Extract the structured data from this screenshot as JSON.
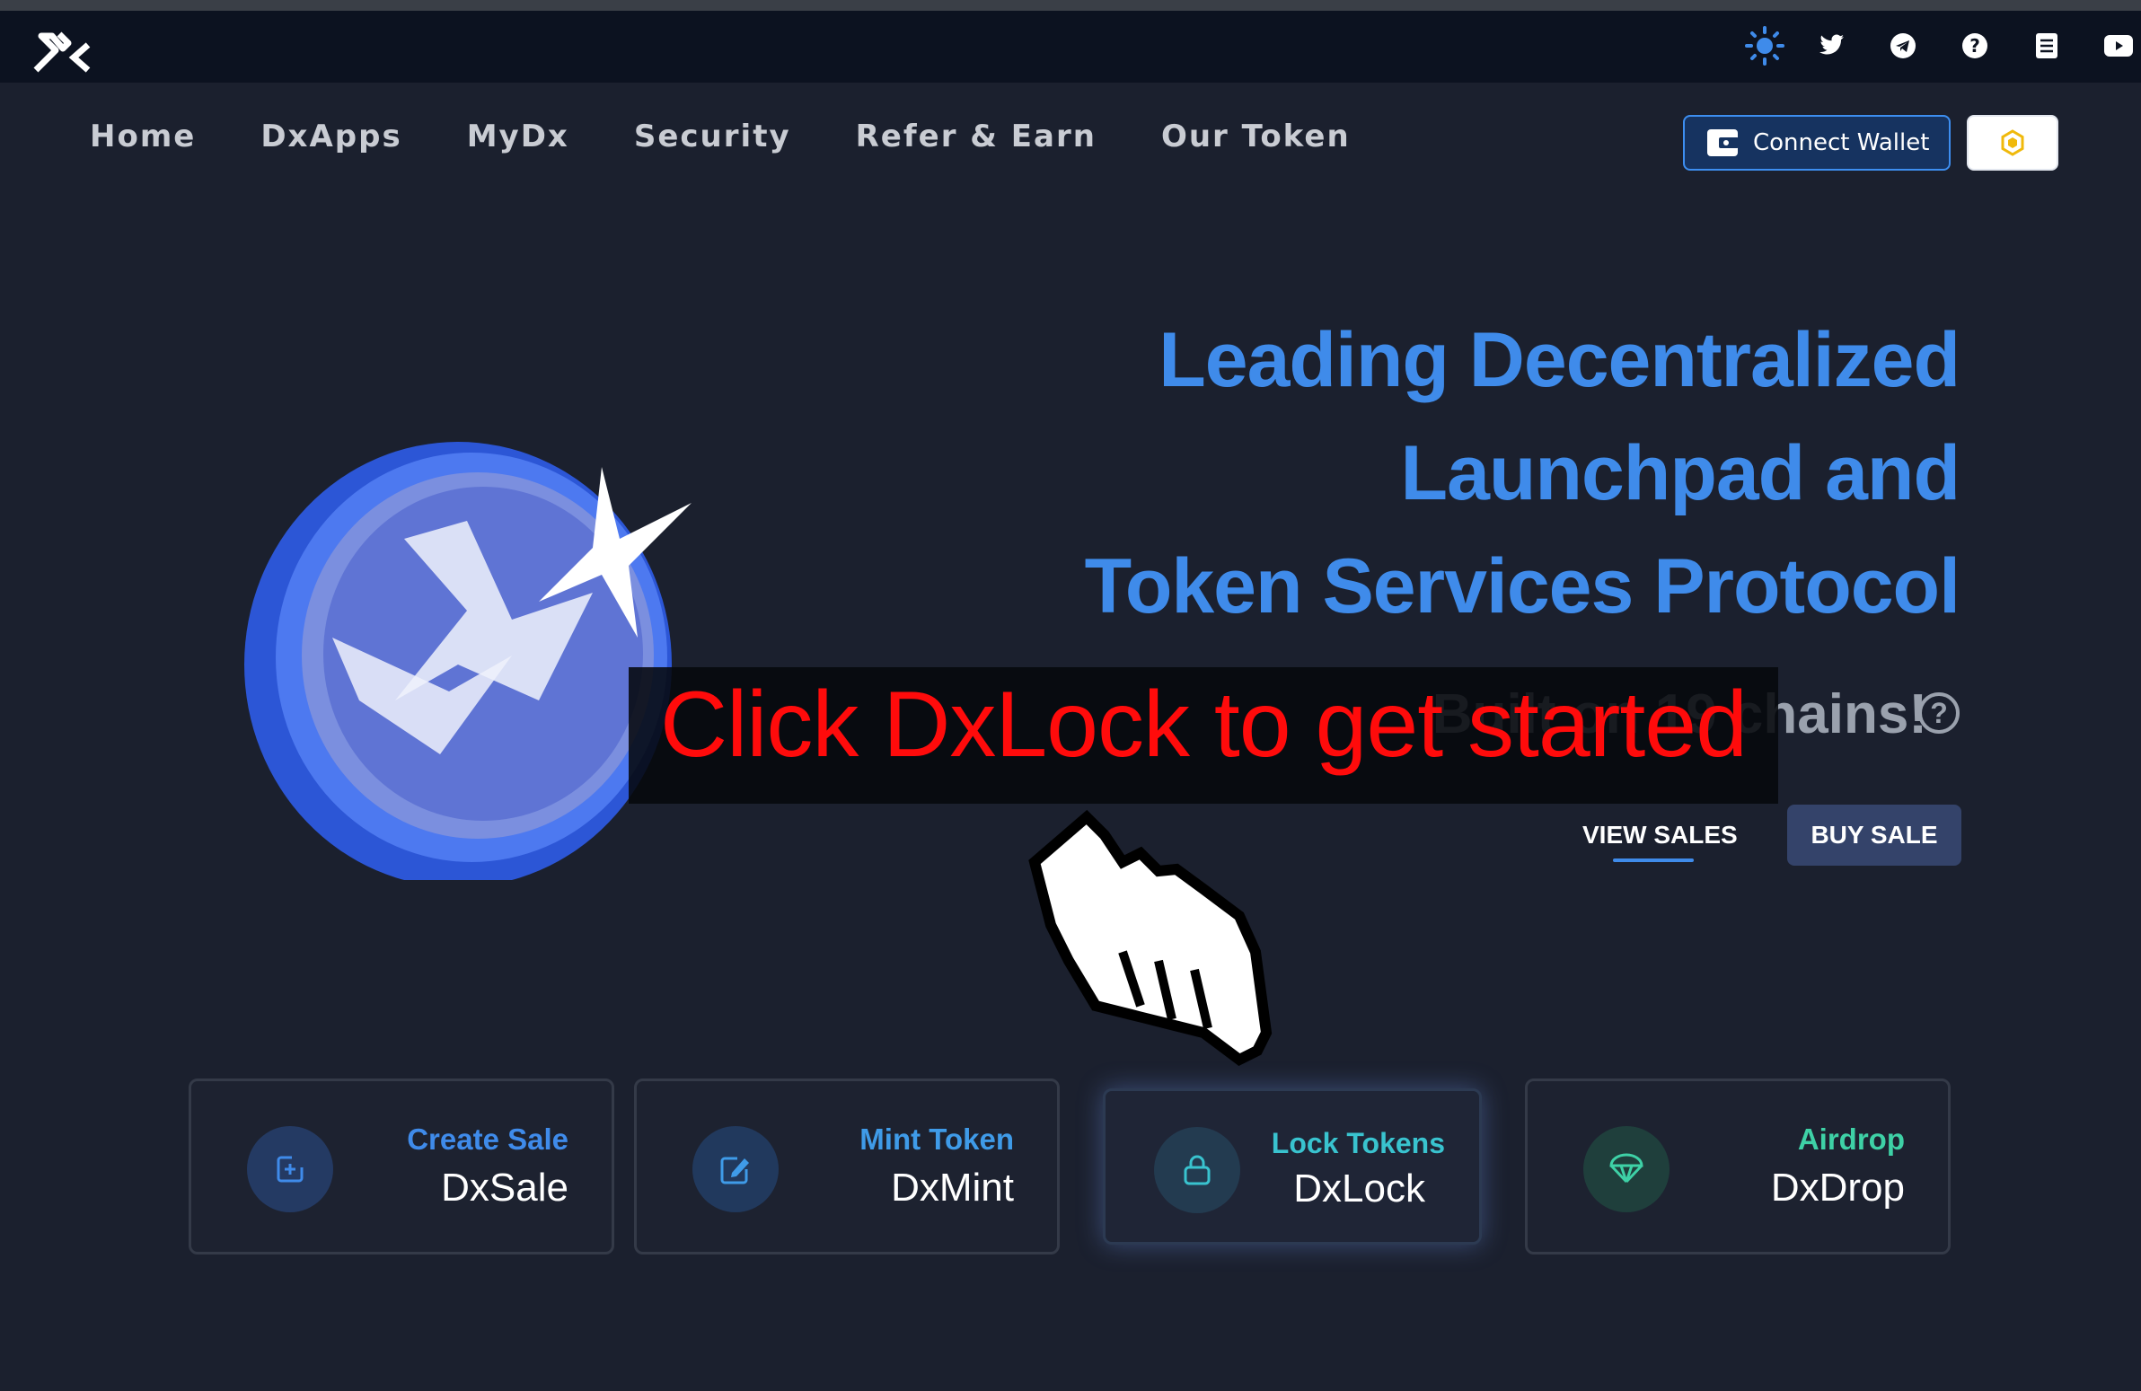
{
  "top_icons": [
    "sun-icon",
    "twitter-icon",
    "telegram-icon",
    "help-icon",
    "docs-icon",
    "youtube-icon",
    "discord-icon"
  ],
  "nav": {
    "items": [
      "Home",
      "DxApps",
      "MyDx",
      "Security",
      "Refer & Earn",
      "Our Token"
    ]
  },
  "header": {
    "connect_wallet": "Connect Wallet"
  },
  "hero": {
    "line1": "Leading Decentralized",
    "line2": "Launchpad and",
    "line3": "Token Services Protocol",
    "built_text": "Built on 19 chains!",
    "view_sales": "VIEW SALES",
    "buy_sale": "BUY SALE"
  },
  "overlay": {
    "instruction": "Click DxLock to get started"
  },
  "cards": [
    {
      "sub": "Create Sale",
      "title": "DxSale",
      "sub_color": "#3f8bea"
    },
    {
      "sub": "Mint Token",
      "title": "DxMint",
      "sub_color": "#3f9be8"
    },
    {
      "sub": "Lock Tokens",
      "title": "DxLock",
      "sub_color": "#39c3cf"
    },
    {
      "sub": "Airdrop",
      "title": "DxDrop",
      "sub_color": "#3ed1a6"
    }
  ],
  "colors": {
    "accent": "#3f8bea",
    "background": "#1b202e",
    "overlay_text": "#ff0b0b"
  }
}
